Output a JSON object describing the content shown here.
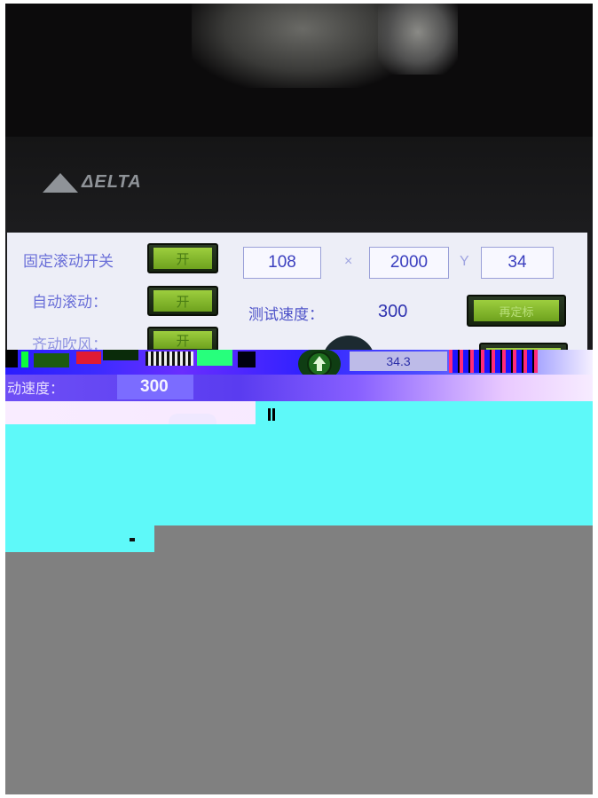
{
  "brand": {
    "logo_text": "ΔELTA"
  },
  "controls": [
    {
      "label": "固定滚动开关",
      "button_label": "开"
    },
    {
      "label": "自动滚动：",
      "button_label": "开"
    },
    {
      "label": "齐动吹风：",
      "button_label": "开"
    }
  ],
  "coordinates": {
    "x_value": "108",
    "x_axis_label": "×",
    "z_value": "2000",
    "y_axis_label": "Y",
    "y_value": "34"
  },
  "test_speed": {
    "label": "测试速度：",
    "value": "300"
  },
  "right_button_label": "再定标",
  "glitch_row": {
    "speed_label": "动速度：",
    "speed_value": "300",
    "reading": "34.3"
  },
  "icons": [
    "delta-logo-icon",
    "up-arrow-icon"
  ],
  "colors": {
    "screen_bg": "#edeef7",
    "label_text": "#6a6fd8",
    "value_text": "#2f33b0",
    "button_green": "#8cc13a"
  }
}
